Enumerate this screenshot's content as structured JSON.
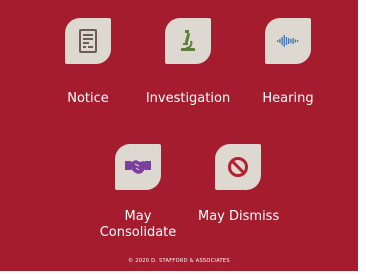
{
  "colors": {
    "background": "#a51c2e",
    "tile": "#ddd9d0",
    "text": "#ffffff",
    "notice_icon": "#6b5f55",
    "investigation_icon": "#5a7f3a",
    "hearing_icon": "#4a79b4",
    "consolidate_icon": "#7b3fa0",
    "dismiss_icon": "#b52032"
  },
  "items": [
    {
      "label": "Notice",
      "icon": "notice-document-icon"
    },
    {
      "label": "Investigation",
      "icon": "microscope-icon"
    },
    {
      "label": "Hearing",
      "icon": "sound-wave-icon"
    },
    {
      "label_lines": [
        "May",
        "Consolidate"
      ],
      "icon": "handshake-icon"
    },
    {
      "label": "May Dismiss",
      "icon": "prohibited-icon"
    }
  ],
  "footer": "© 2020 D. STAFFORD & ASSOCIATES"
}
